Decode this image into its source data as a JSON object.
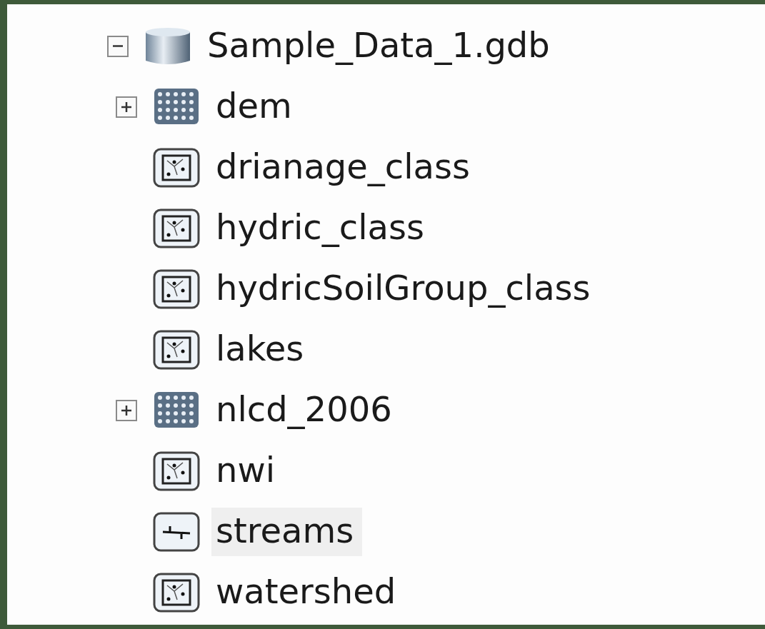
{
  "tree": {
    "label": "Sample_Data_1.gdb",
    "kind": "geodatabase",
    "expanded": true,
    "children": [
      {
        "label": "dem",
        "kind": "raster",
        "expanded": false,
        "selected": false
      },
      {
        "label": "drianage_class",
        "kind": "polygon",
        "selected": false
      },
      {
        "label": "hydric_class",
        "kind": "polygon",
        "selected": false
      },
      {
        "label": "hydricSoilGroup_class",
        "kind": "polygon",
        "selected": false
      },
      {
        "label": "lakes",
        "kind": "polygon",
        "selected": false
      },
      {
        "label": "nlcd_2006",
        "kind": "raster",
        "expanded": false,
        "selected": false
      },
      {
        "label": "nwi",
        "kind": "polygon",
        "selected": false
      },
      {
        "label": "streams",
        "kind": "line",
        "selected": true
      },
      {
        "label": "watershed",
        "kind": "polygon",
        "selected": false
      }
    ]
  }
}
